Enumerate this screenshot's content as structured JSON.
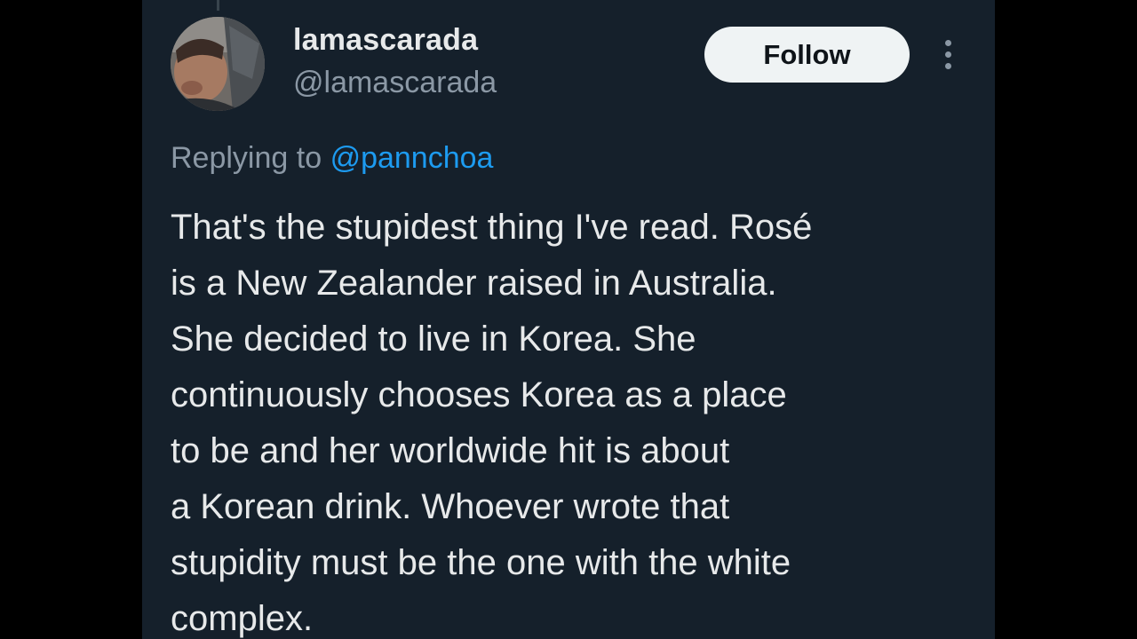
{
  "tweet": {
    "author": {
      "display_name": "lamascarada",
      "handle": "@lamascarada",
      "avatar_icon": "profile-photo"
    },
    "follow_label": "Follow",
    "more_icon": "more-options-vertical-dots",
    "reply": {
      "prefix": "Replying to",
      "mention": "@pannchoa"
    },
    "text_lines": [
      "That's the stupidest thing I've read. Rosé",
      "is a New Zealander raised in Australia.",
      "She decided to live in Korea. She",
      "continuously chooses Korea as a place",
      "to be and her worldwide hit is about",
      "a Korean drink. Whoever wrote that",
      "stupidity must be the one with the white",
      "complex."
    ]
  },
  "colors": {
    "page_background": "#000000",
    "card_background": "#15202b",
    "primary_text": "#e7e9ea",
    "secondary_text": "#8b98a5",
    "link": "#1d9bf0",
    "follow_button_background": "#eff3f4",
    "follow_button_text": "#0f1419"
  }
}
